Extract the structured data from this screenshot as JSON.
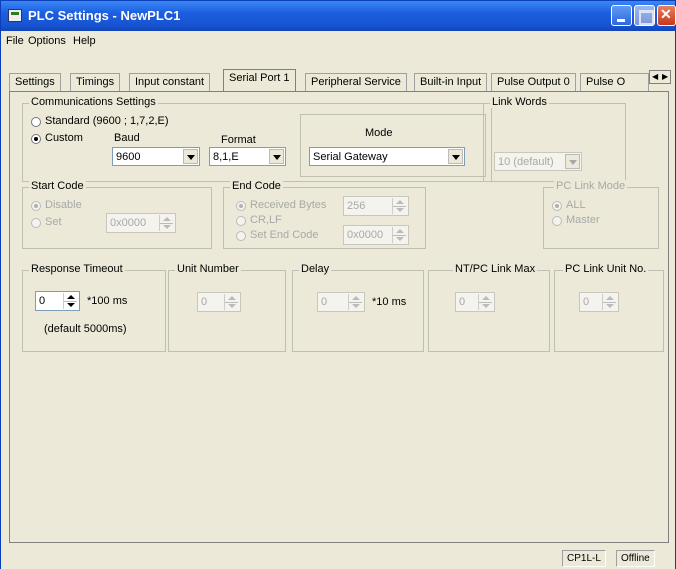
{
  "window": {
    "title": "PLC Settings - NewPLC1"
  },
  "menu": {
    "file": "File",
    "options": "Options",
    "help": "Help"
  },
  "tabs": [
    "Settings",
    "Timings",
    "Input constant",
    "Serial Port 1",
    "Peripheral Service",
    "Built-in Input",
    "Pulse Output 0",
    "Pulse O"
  ],
  "comm": {
    "group_label": "Communications Settings",
    "standard_label": "Standard (9600 ; 1,7,2,E)",
    "custom_label": "Custom",
    "baud_label": "Baud",
    "baud_value": "9600",
    "format_label": "Format",
    "format_value": "8,1,E",
    "mode_label": "Mode",
    "mode_value": "Serial Gateway"
  },
  "link_words": {
    "group_label": "Link Words",
    "value": "10 (default)"
  },
  "start_code": {
    "group_label": "Start Code",
    "disable_label": "Disable",
    "set_label": "Set",
    "value": "0x0000"
  },
  "end_code": {
    "group_label": "End Code",
    "received_label": "Received Bytes",
    "received_value": "256",
    "crlf_label": "CR,LF",
    "set_label": "Set End Code",
    "set_value": "0x0000"
  },
  "pc_link_mode": {
    "group_label": "PC Link Mode",
    "all_label": "ALL",
    "master_label": "Master"
  },
  "response_timeout": {
    "group_label": "Response Timeout",
    "value": "0",
    "unit": "*100 ms",
    "note": "(default 5000ms)"
  },
  "unit_number": {
    "group_label": "Unit Number",
    "value": "0"
  },
  "delay": {
    "group_label": "Delay",
    "value": "0",
    "unit": "*10 ms"
  },
  "nt_pc_link_max": {
    "group_label": "NT/PC Link Max",
    "value": "0"
  },
  "pc_link_unit_no": {
    "group_label": "PC Link Unit No.",
    "value": "0"
  },
  "status": {
    "model": "CP1L-L",
    "state": "Offline"
  }
}
